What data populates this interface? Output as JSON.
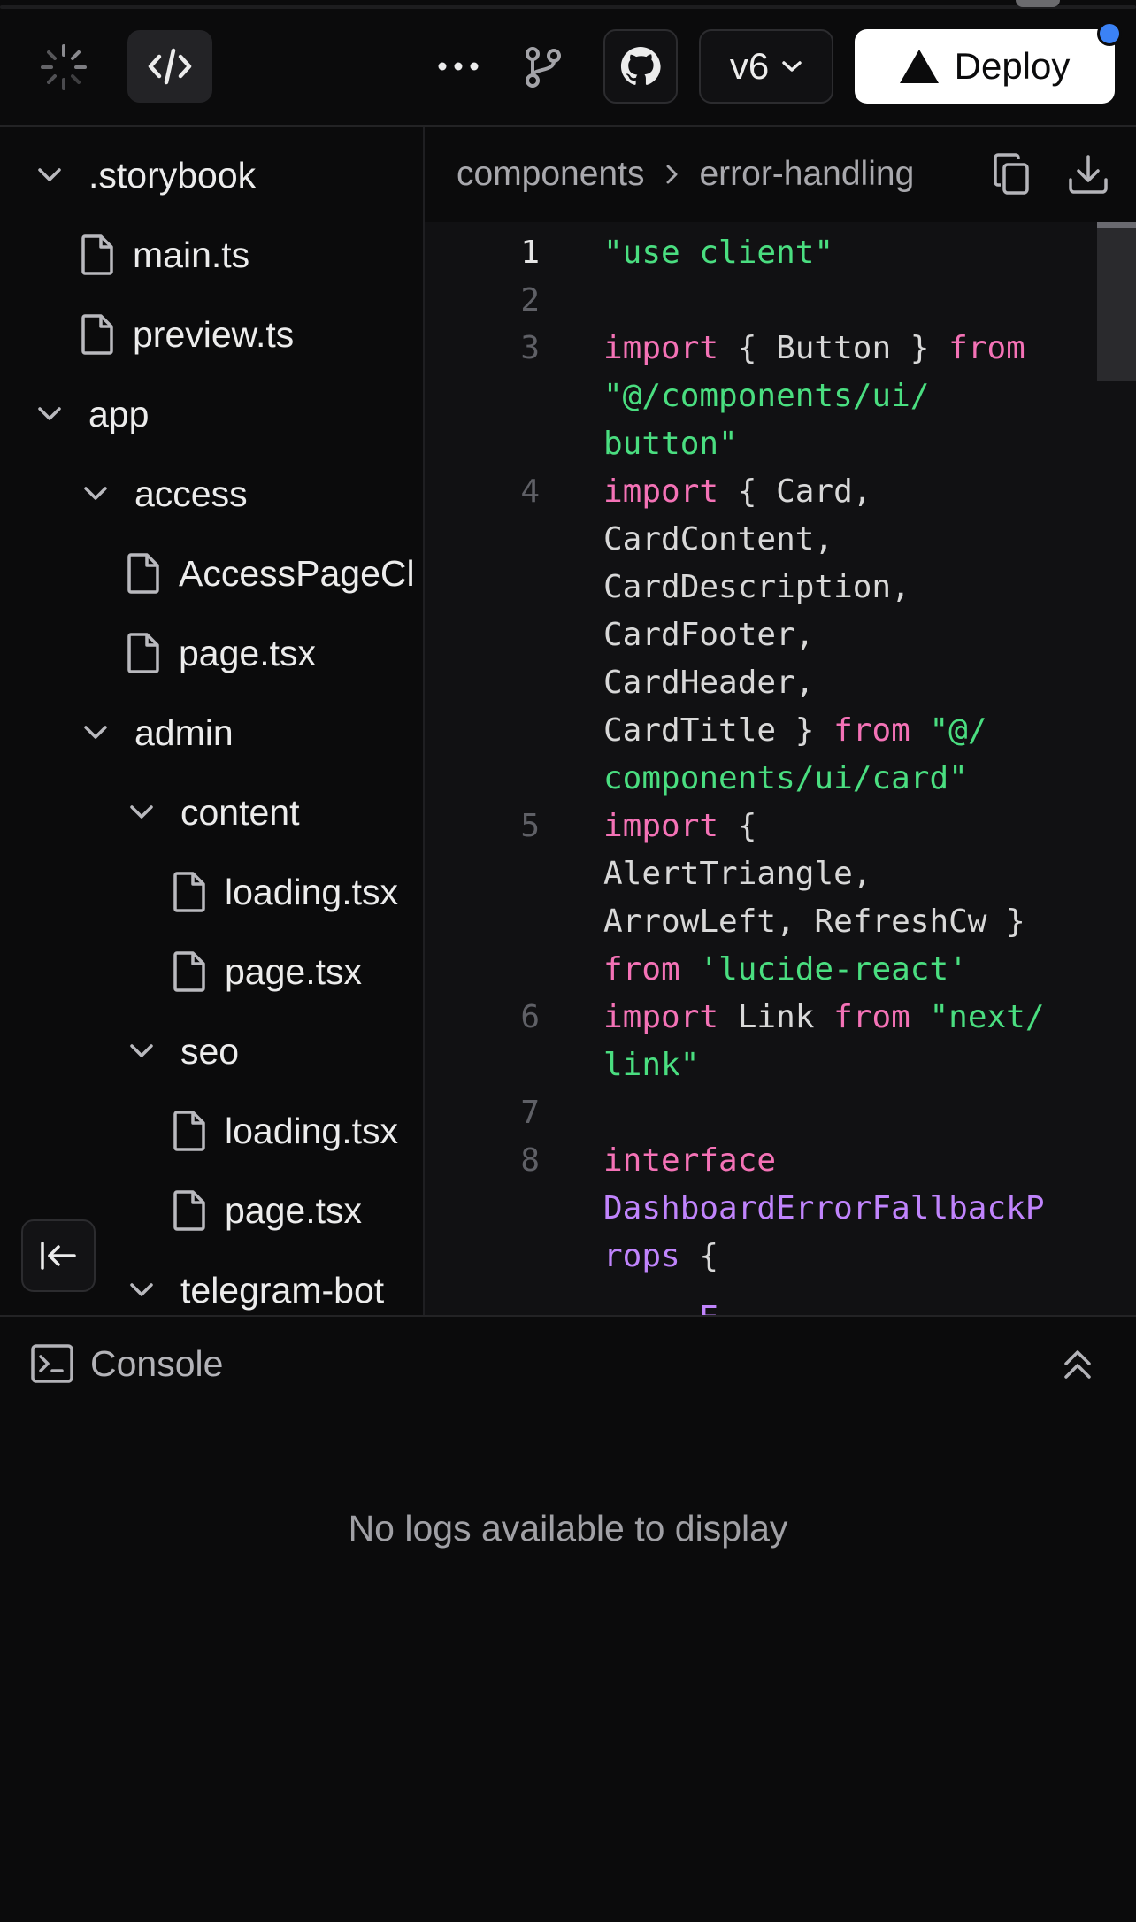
{
  "toolbar": {
    "version_label": "v6",
    "deploy_label": "Deploy"
  },
  "tree": {
    "items": [
      {
        "label": ".storybook",
        "kind": "folder",
        "depth": 0
      },
      {
        "label": "main.ts",
        "kind": "file",
        "depth": 1
      },
      {
        "label": "preview.ts",
        "kind": "file",
        "depth": 1
      },
      {
        "label": "app",
        "kind": "folder",
        "depth": 0
      },
      {
        "label": "access",
        "kind": "folder",
        "depth": 1
      },
      {
        "label": "AccessPageCl",
        "kind": "file",
        "depth": 2
      },
      {
        "label": "page.tsx",
        "kind": "file",
        "depth": 2
      },
      {
        "label": "admin",
        "kind": "folder",
        "depth": 1
      },
      {
        "label": "content",
        "kind": "folder",
        "depth": 2
      },
      {
        "label": "loading.tsx",
        "kind": "file",
        "depth": 3
      },
      {
        "label": "page.tsx",
        "kind": "file",
        "depth": 3
      },
      {
        "label": "seo",
        "kind": "folder",
        "depth": 2
      },
      {
        "label": "loading.tsx",
        "kind": "file",
        "depth": 3
      },
      {
        "label": "page.tsx",
        "kind": "file",
        "depth": 3
      },
      {
        "label": "telegram-bot",
        "kind": "folder",
        "depth": 2
      }
    ]
  },
  "editor": {
    "breadcrumb": [
      "components",
      "error-handling"
    ],
    "line_numbers": [
      "1",
      "2",
      "3",
      "4",
      "5",
      "6",
      "7",
      "8"
    ],
    "code": [
      [
        {
          "t": "\"use client\"",
          "c": "str"
        }
      ],
      [],
      [
        {
          "t": "import",
          "c": "kw"
        },
        {
          "t": " { Button } ",
          "c": ""
        },
        {
          "t": "from",
          "c": "kw"
        }
      ],
      [
        {
          "t": "\"@/components/ui/",
          "c": "str"
        }
      ],
      [
        {
          "t": "button\"",
          "c": "str"
        }
      ],
      [
        {
          "t": "import",
          "c": "kw"
        },
        {
          "t": " { Card,",
          "c": ""
        }
      ],
      [
        {
          "t": "CardContent,",
          "c": ""
        }
      ],
      [
        {
          "t": "CardDescription,",
          "c": ""
        }
      ],
      [
        {
          "t": "CardFooter,",
          "c": ""
        }
      ],
      [
        {
          "t": "CardHeader,",
          "c": ""
        }
      ],
      [
        {
          "t": "CardTitle } ",
          "c": ""
        },
        {
          "t": "from",
          "c": "kw"
        },
        {
          "t": " \"@/",
          "c": "str"
        }
      ],
      [
        {
          "t": "components/ui/card\"",
          "c": "str"
        }
      ],
      [
        {
          "t": "import",
          "c": "kw"
        },
        {
          "t": " {",
          "c": ""
        }
      ],
      [
        {
          "t": "AlertTriangle,",
          "c": ""
        }
      ],
      [
        {
          "t": "ArrowLeft, RefreshCw }",
          "c": ""
        }
      ],
      [
        {
          "t": "from",
          "c": "kw"
        },
        {
          "t": " ",
          "c": ""
        },
        {
          "t": "'lucide-react'",
          "c": "str"
        }
      ],
      [
        {
          "t": "import",
          "c": "kw"
        },
        {
          "t": " Link ",
          "c": ""
        },
        {
          "t": "from",
          "c": "kw"
        },
        {
          "t": " \"next/",
          "c": "str"
        }
      ],
      [
        {
          "t": "link\"",
          "c": "str"
        }
      ],
      [],
      [
        {
          "t": "interface",
          "c": "kw"
        }
      ],
      [
        {
          "t": "DashboardErrorFallbackP",
          "c": "type"
        }
      ],
      [
        {
          "t": "rops",
          "c": "type"
        },
        {
          "t": " {",
          "c": ""
        }
      ]
    ]
  },
  "console": {
    "title": "Console",
    "empty_message": "No logs available to display"
  }
}
